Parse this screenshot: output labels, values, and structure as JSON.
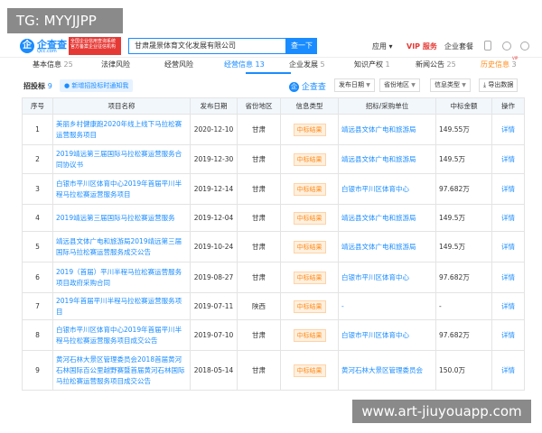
{
  "watermark": {
    "top": "TG: MYYJJPP",
    "bottom": "www.art-jiuyouapp.com"
  },
  "header": {
    "logo_text": "企查查",
    "logo_sub": "Qcc.com",
    "slogan": "全国企业信用查询系统 官方备案企业征信机构",
    "search_value": "甘肃晟景体育文化发展有限公司",
    "search_button": "查一下",
    "nav_app": "应用 ▾",
    "nav_vip": "VIP 服务",
    "nav_enterprise": "企业套餐"
  },
  "tabs": [
    {
      "label": "基本信息",
      "count": "25"
    },
    {
      "label": "法律风险",
      "count": ""
    },
    {
      "label": "经营风险",
      "count": ""
    },
    {
      "label": "经营信息",
      "count": "13"
    },
    {
      "label": "企业发展",
      "count": "5"
    },
    {
      "label": "知识产权",
      "count": "1"
    },
    {
      "label": "新闻公告",
      "count": "25"
    },
    {
      "label": "历史信息",
      "count": "3"
    }
  ],
  "tab_vip_badge": "VIP",
  "toolbar": {
    "title": "招投标",
    "count": "9",
    "new_label": "● 新增招投标时通知我",
    "brand": "企查查",
    "filter_date": "发布日期",
    "filter_region": "省份地区",
    "filter_type": "信息类型",
    "export": "导出数据"
  },
  "table": {
    "headers": [
      "序号",
      "项目名称",
      "发布日期",
      "省份地区",
      "信息类型",
      "招标/采购单位",
      "中标金额",
      "操作"
    ],
    "rows": [
      {
        "no": "1",
        "name": "美丽乡村健康跑2020年线上线下马拉松赛运营服务项目",
        "date": "2020-12-10",
        "region": "甘肃",
        "type": "中标结果",
        "unit": "靖远县文体广电和旅游局",
        "amount": "149.55万",
        "op": "详情"
      },
      {
        "no": "2",
        "name": "2019靖远第三届国际马拉松赛运营服务合同协议书",
        "date": "2019-12-30",
        "region": "甘肃",
        "type": "中标结果",
        "unit": "靖远县文体广电和旅游局",
        "amount": "149.5万",
        "op": "详情"
      },
      {
        "no": "3",
        "name": "白银市平川区体育中心2019年首届平川半程马拉松赛运营服务项目",
        "date": "2019-12-14",
        "region": "甘肃",
        "type": "中标结果",
        "unit": "白银市平川区体育中心",
        "amount": "97.682万",
        "op": "详情"
      },
      {
        "no": "4",
        "name": "2019靖远第三届国际马拉松赛运营服务",
        "date": "2019-12-04",
        "region": "甘肃",
        "type": "中标结果",
        "unit": "靖远县文体广电和旅游局",
        "amount": "149.5万",
        "op": "详情"
      },
      {
        "no": "5",
        "name": "靖远县文体广电和旅游局2019靖远第三届国际马拉松赛运营服务成交公告",
        "date": "2019-10-24",
        "region": "甘肃",
        "type": "中标结果",
        "unit": "靖远县文体广电和旅游局",
        "amount": "149.5万",
        "op": "详情"
      },
      {
        "no": "6",
        "name": "2019（首届）平川半程马拉松赛运营服务项目政府采购合同",
        "date": "2019-08-27",
        "region": "甘肃",
        "type": "中标结果",
        "unit": "白银市平川区体育中心",
        "amount": "97.682万",
        "op": "详情"
      },
      {
        "no": "7",
        "name": "2019年首届平川半程马拉松赛运营服务项目",
        "date": "2019-07-11",
        "region": "陕西",
        "type": "中标结果",
        "unit": "-",
        "amount": "-",
        "op": "详情"
      },
      {
        "no": "8",
        "name": "白银市平川区体育中心2019年首届平川半程马拉松赛运营服务项目成交公告",
        "date": "2019-07-10",
        "region": "甘肃",
        "type": "中标结果",
        "unit": "白银市平川区体育中心",
        "amount": "97.682万",
        "op": "详情"
      },
      {
        "no": "9",
        "name": "黄河石林大景区管理委员会2018首届黄河石林国际百公里越野赛暨首届黄河石林国际马拉松赛运营服务项目成交公告",
        "date": "2018-05-14",
        "region": "甘肃",
        "type": "中标结果",
        "unit": "黄河石林大景区管理委员会",
        "amount": "150.0万",
        "op": "详情"
      }
    ]
  }
}
